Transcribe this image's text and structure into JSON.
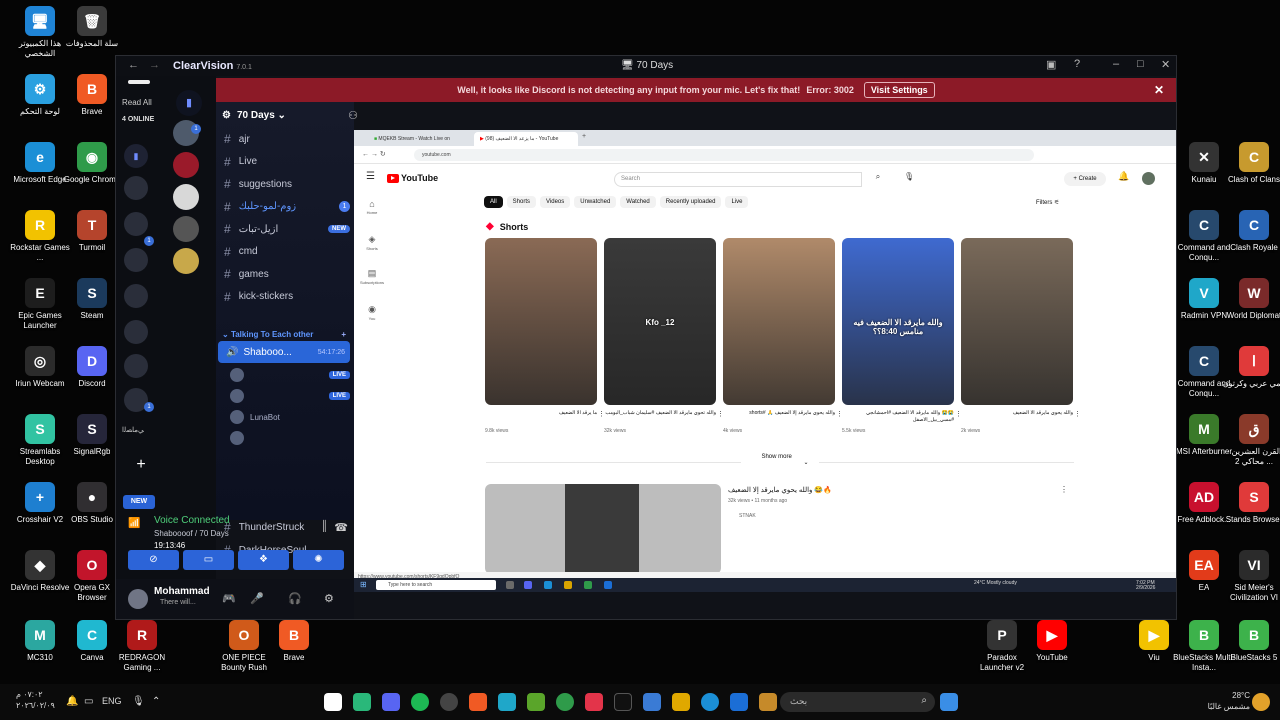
{
  "desktop_icons_left": [
    {
      "label": "هذا الكمبيوتر الشخصي",
      "color": "#1f84d6",
      "glyph": "🖥"
    },
    {
      "label": "سلة المحذوفات",
      "color": "#3b3b3b",
      "glyph": "🗑"
    },
    {
      "label": "لوحة التحكم",
      "color": "#2aa0e0",
      "glyph": "⚙"
    },
    {
      "label": "Brave",
      "color": "#f05a24",
      "glyph": "B"
    },
    {
      "label": "Microsoft Edge",
      "color": "#1b8fd6",
      "glyph": "e"
    },
    {
      "label": "Google Chrome",
      "color": "#2f9b4a",
      "glyph": "◉"
    },
    {
      "label": "Rockstar Games ...",
      "color": "#f2c200",
      "glyph": "R"
    },
    {
      "label": "Turmoil",
      "color": "#b5442c",
      "glyph": "T"
    },
    {
      "label": "Epic Games Launcher",
      "color": "#1d1d1d",
      "glyph": "E"
    },
    {
      "label": "Steam",
      "color": "#1b3a5c",
      "glyph": "S"
    },
    {
      "label": "Iriun Webcam",
      "color": "#2b2b2b",
      "glyph": "◎"
    },
    {
      "label": "Discord",
      "color": "#5865f2",
      "glyph": "D"
    },
    {
      "label": "Streamlabs Desktop",
      "color": "#31c3a2",
      "glyph": "S"
    },
    {
      "label": "SignalRgb",
      "color": "#26263a",
      "glyph": "S"
    },
    {
      "label": "Crosshair V2",
      "color": "#1e7fd0",
      "glyph": "+"
    },
    {
      "label": "OBS Studio",
      "color": "#302e31",
      "glyph": "●"
    },
    {
      "label": "DaVinci Resolve",
      "color": "#333",
      "glyph": "◆"
    },
    {
      "label": "Opera GX Browser",
      "color": "#c2152b",
      "glyph": "O"
    },
    {
      "label": "MC310",
      "color": "#2ba7a0",
      "glyph": "M"
    },
    {
      "label": "Canva",
      "color": "#20b8d0",
      "glyph": "C"
    },
    {
      "label": "REDRAGON Gaming ...",
      "color": "#b01a1a",
      "glyph": "R"
    },
    {
      "label": "ONE PIECE Bounty Rush",
      "color": "#d05a1a",
      "glyph": "O"
    },
    {
      "label": "Brave",
      "color": "#f05a24",
      "glyph": "B"
    }
  ],
  "desktop_icons_right": [
    {
      "label": "Kunaiu",
      "color": "#333",
      "glyph": "✕"
    },
    {
      "label": "Clash of Clans",
      "color": "#c79a2e",
      "glyph": "C"
    },
    {
      "label": "Command and Conqu...",
      "color": "#27496d",
      "glyph": "C"
    },
    {
      "label": "Clash Royale",
      "color": "#2864b4",
      "glyph": "C"
    },
    {
      "label": "Radmin VPN",
      "color": "#1fa7c9",
      "glyph": "V"
    },
    {
      "label": "World Diplomat",
      "color": "#7a2a2a",
      "glyph": "W"
    },
    {
      "label": "Command and Conqu...",
      "color": "#27496d",
      "glyph": "C"
    },
    {
      "label": "انمي عربي وكرتون",
      "color": "#e03a3a",
      "glyph": "ا"
    },
    {
      "label": "MSI Afterburner",
      "color": "#3a7a2a",
      "glyph": "M"
    },
    {
      "label": "القرن العشرين - محاكي 2 ...",
      "color": "#8a3a2a",
      "glyph": "ق"
    },
    {
      "label": "Free Adblock...",
      "color": "#c8102e",
      "glyph": "AD"
    },
    {
      "label": "Stands Browser",
      "color": "#e03a3a",
      "glyph": "S"
    },
    {
      "label": "EA",
      "color": "#e23b1a",
      "glyph": "EA"
    },
    {
      "label": "Sid Meier's Civilization VI",
      "color": "#2b2b2b",
      "glyph": "VI"
    },
    {
      "label": "Paradox Launcher v2",
      "color": "#333",
      "glyph": "P"
    },
    {
      "label": "YouTube",
      "color": "#ff0000",
      "glyph": "▶"
    },
    {
      "label": "Viu",
      "color": "#f2c200",
      "glyph": "▶"
    },
    {
      "label": "BlueStacks Multi-Insta...",
      "color": "#3db24b",
      "glyph": "B"
    },
    {
      "label": "BlueStacks 5",
      "color": "#3db24b",
      "glyph": "B"
    }
  ],
  "discord": {
    "brand": "ClearVision",
    "version": "7.0.1",
    "window_title": "70 Days",
    "banner_text": "Well, it looks like Discord is not detecting any input from your mic. Let's fix that!",
    "banner_error": "Error: 3002",
    "banner_button": "Visit Settings",
    "read_all": "Read All",
    "online": "4 ONLINE",
    "new_label": "NEW",
    "server_name": "70 Days",
    "channels": [
      {
        "name": "ajr",
        "unread": false
      },
      {
        "name": "Live",
        "unread": false
      },
      {
        "name": "suggestions",
        "unread": false
      },
      {
        "name": "زوم-لمو-حلبك",
        "unread": true,
        "badge": "1"
      },
      {
        "name": "ازيل-تبات",
        "unread": false,
        "tag": "NEW"
      },
      {
        "name": "cmd",
        "unread": false
      },
      {
        "name": "games",
        "unread": false
      },
      {
        "name": "kick-stickers",
        "unread": false
      }
    ],
    "category": "Talking To Each other",
    "voice_channel": "Shabooo...",
    "voice_timer": "54:17:26",
    "voice_users": [
      {
        "name": "",
        "live": "LIVE"
      },
      {
        "name": "",
        "live": "LIVE"
      },
      {
        "name": "LunaBot",
        "live": ""
      },
      {
        "name": "",
        "live": ""
      }
    ],
    "more_channels": [
      "ThunderStruck",
      "DarkHorseSoul"
    ],
    "voice_connected": "Voice Connected",
    "voice_server": "Shaboooof / 70 Days",
    "voice_time": "19:13:46",
    "user_name": "Mohammad",
    "user_status": "There will..."
  },
  "browser": {
    "tabs": [
      "MQEKB Stream - Watch Live on",
      "ما يزعد الا الضعيف (98) - YouTube"
    ],
    "url": "youtube.com",
    "yt_logo": "YouTube",
    "search_placeholder": "Search",
    "create": "Create",
    "side": [
      "Home",
      "Shorts",
      "Subscriptions",
      "You"
    ],
    "chips": [
      "All",
      "Shorts",
      "Videos",
      "Unwatched",
      "Watched",
      "Recently uploaded",
      "Live"
    ],
    "filters": "Filters",
    "shorts_title": "Shorts",
    "shorts": [
      {
        "title": "ما يرقد الا الضعيف",
        "views": "9.8k views",
        "overlay": "",
        "color": "#8a6a55"
      },
      {
        "title": "والله تحوي مايرقد الا الضعيف #سليمان شباب_البومب",
        "views": "32k views",
        "overlay": "Kfo _12",
        "color": "#3a3a3a"
      },
      {
        "title": "والله يحوي مايرقد إلا الضعيف 🙏 #shorts",
        "views": "4k views",
        "overlay": "",
        "color": "#b08a6a"
      },
      {
        "title": "😭😭 والله مايرقد الا الضعيف #احمشانجي #مسي_بيل_الاصفل",
        "views": "5.5k views",
        "overlay": "والله مايرقد الا الضعيف فيه منامس 8:40؟؟",
        "color": "#3f6ad0"
      },
      {
        "title": "والله يحوي مايرقد الا الضعيف",
        "views": "2k views",
        "overlay": "",
        "color": "#7a6a5a"
      }
    ],
    "show_more": "Show more",
    "video_title": "والله يحوي مايرقد إلا الضعيف 😂🔥",
    "video_meta": "32k views • 11 months ago",
    "video_channel": "STNAK",
    "status_url": "https://www.youtube.com/shorts/KF9gdOpbfQ",
    "win_search": "Type here to search",
    "win_weather": "24°C  Mostly cloudy",
    "win_time": "7:02 PM",
    "win_date": "2/9/2026"
  },
  "taskbar": {
    "time": "٠٧:٠٢ م",
    "date": "٢٠٢٦/٠٢/٠٩",
    "lang": "ENG",
    "search": "بحث",
    "temp": "28°C",
    "weather": "مشمس غالبًا"
  }
}
